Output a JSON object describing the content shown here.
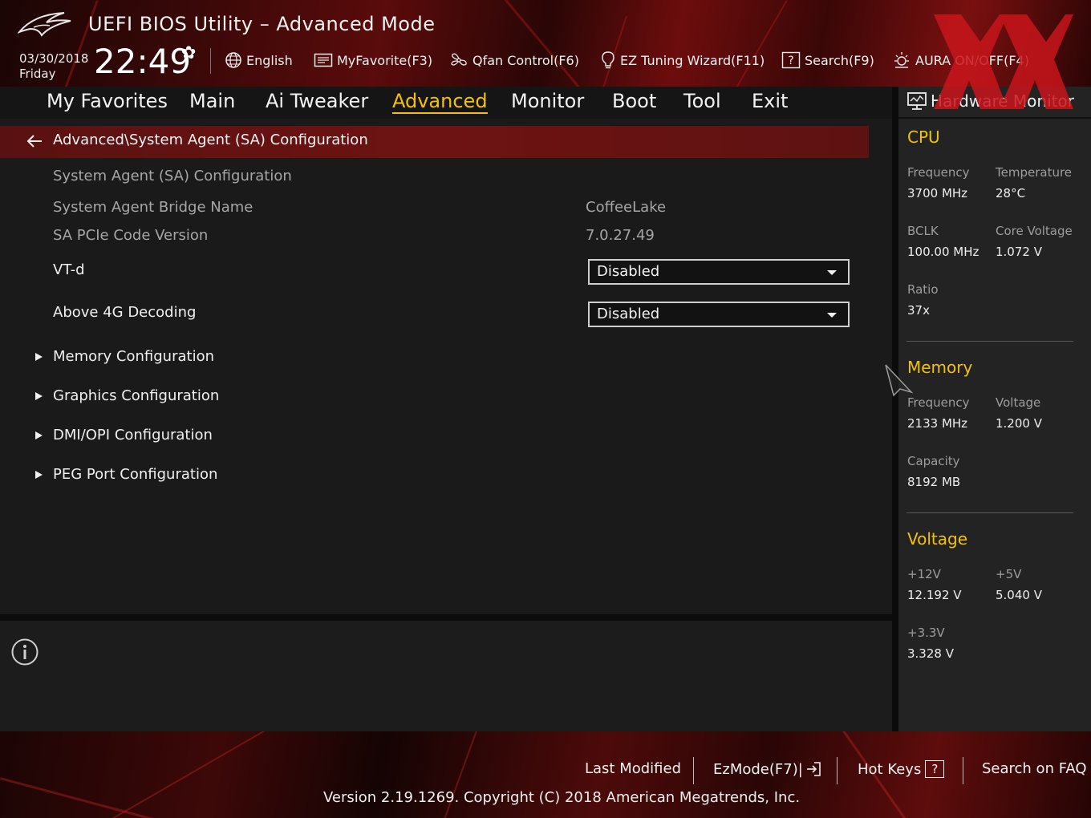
{
  "app": {
    "title": "UEFI BIOS Utility – Advanced Mode",
    "date": "03/30/2018",
    "day": "Friday",
    "time": "22:49"
  },
  "toolbar": {
    "language": "English",
    "favorite": "MyFavorite(F3)",
    "qfan": "Qfan Control(F6)",
    "ez_tuning": "EZ Tuning Wizard(F11)",
    "search": "Search(F9)",
    "aura": "AURA ON/OFF(F4)"
  },
  "nav": {
    "tabs": [
      {
        "label": "My Favorites"
      },
      {
        "label": "Main"
      },
      {
        "label": "Ai Tweaker"
      },
      {
        "label": "Advanced"
      },
      {
        "label": "Monitor"
      },
      {
        "label": "Boot"
      },
      {
        "label": "Tool"
      },
      {
        "label": "Exit"
      }
    ],
    "active": "Advanced"
  },
  "main": {
    "breadcrumb": "Advanced\\System Agent (SA) Configuration",
    "section_title": "System Agent (SA) Configuration",
    "bridge_name_label": "System Agent Bridge Name",
    "bridge_name_value": "CoffeeLake",
    "pcie_code_label": "SA PCIe Code Version",
    "pcie_code_value": "7.0.27.49",
    "vtd_label": "VT-d",
    "vtd_value": "Disabled",
    "above4g_label": "Above 4G Decoding",
    "above4g_value": "Disabled",
    "submenus": [
      {
        "label": "Memory Configuration"
      },
      {
        "label": "Graphics Configuration"
      },
      {
        "label": "DMI/OPI Configuration"
      },
      {
        "label": "PEG Port Configuration"
      }
    ]
  },
  "hw_monitor": {
    "title": "Hardware Monitor",
    "cpu": {
      "heading": "CPU",
      "frequency_label": "Frequency",
      "frequency_value": "3700 MHz",
      "temperature_label": "Temperature",
      "temperature_value": "28°C",
      "bclk_label": "BCLK",
      "bclk_value": "100.00 MHz",
      "core_voltage_label": "Core Voltage",
      "core_voltage_value": "1.072 V",
      "ratio_label": "Ratio",
      "ratio_value": "37x"
    },
    "memory": {
      "heading": "Memory",
      "frequency_label": "Frequency",
      "frequency_value": "2133 MHz",
      "voltage_label": "Voltage",
      "voltage_value": "1.200 V",
      "capacity_label": "Capacity",
      "capacity_value": "8192 MB"
    },
    "voltage": {
      "heading": "Voltage",
      "v12_label": "+12V",
      "v12_value": "12.192 V",
      "v5_label": "+5V",
      "v5_value": "5.040 V",
      "v33_label": "+3.3V",
      "v33_value": "3.328 V"
    }
  },
  "footer": {
    "last_modified": "Last Modified",
    "ezmode": "EzMode(F7)|",
    "hotkeys": "Hot Keys",
    "hotkeys_key": "?",
    "faq": "Search on FAQ",
    "version": "Version 2.19.1269. Copyright (C) 2018 American Megatrends, Inc."
  },
  "colors": {
    "accent": "#f2c20a",
    "brand_red": "#6e1313",
    "background": "#1a1a1a"
  },
  "icons": [
    "rog-logo-icon",
    "gear-icon",
    "globe-icon",
    "favorite-icon",
    "fan-icon",
    "lightbulb-icon",
    "search-icon",
    "aura-icon",
    "back-arrow-icon",
    "chevron-right-icon",
    "dropdown-caret-icon",
    "info-icon",
    "monitor-icon",
    "exit-icon",
    "mouse-pointer-icon"
  ]
}
